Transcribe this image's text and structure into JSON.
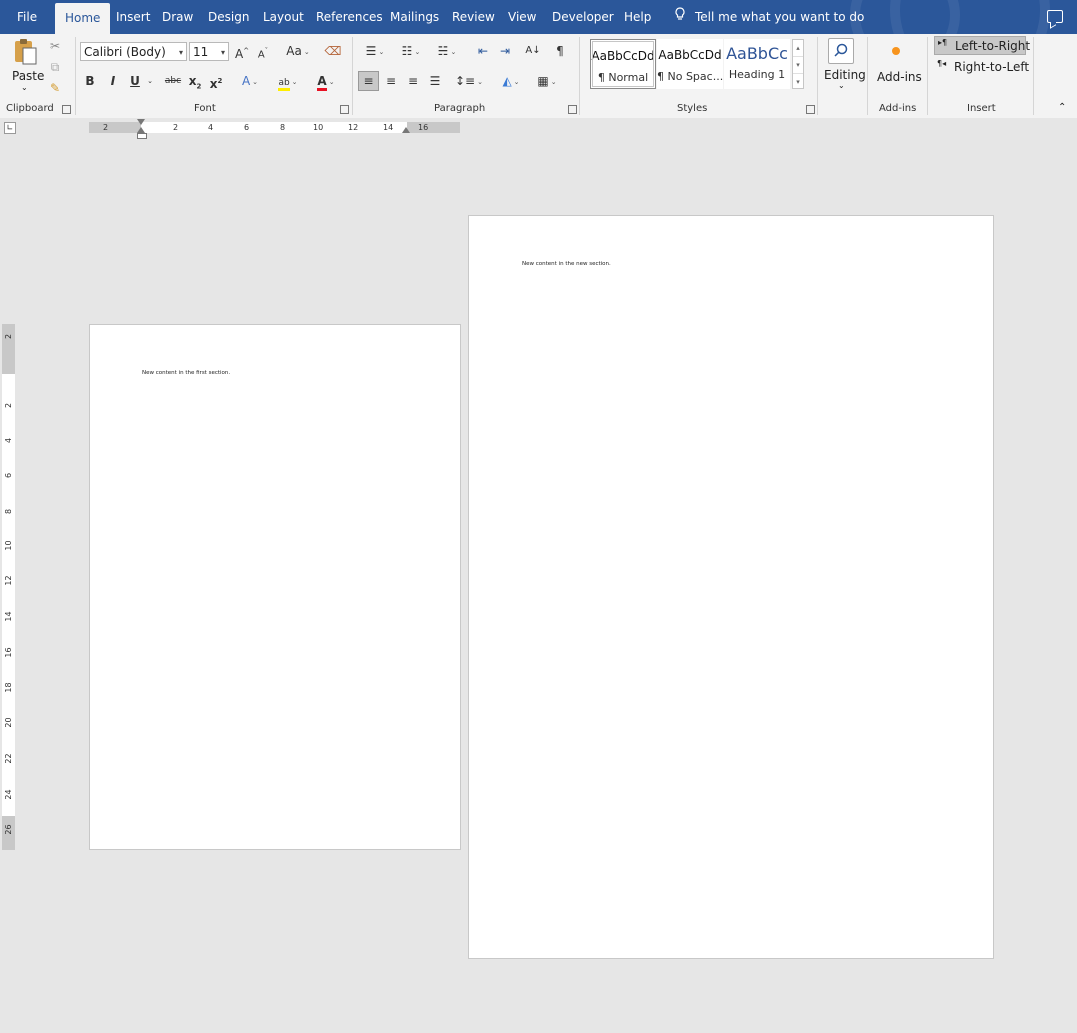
{
  "tabs": [
    {
      "label": "File",
      "active": false
    },
    {
      "label": "Home",
      "active": true
    },
    {
      "label": "Insert",
      "active": false
    },
    {
      "label": "Draw",
      "active": false
    },
    {
      "label": "Design",
      "active": false
    },
    {
      "label": "Layout",
      "active": false
    },
    {
      "label": "References",
      "active": false
    },
    {
      "label": "Mailings",
      "active": false
    },
    {
      "label": "Review",
      "active": false
    },
    {
      "label": "View",
      "active": false
    },
    {
      "label": "Developer",
      "active": false
    },
    {
      "label": "Help",
      "active": false
    }
  ],
  "tell_me": "Tell me what you want to do",
  "clipboard": {
    "paste_label": "Paste",
    "group_label": "Clipboard"
  },
  "font": {
    "font_name": "Calibri (Body)",
    "font_size": "11",
    "grow_label": "A",
    "shrink_label": "A",
    "case_label": "Aa",
    "bold": "B",
    "italic": "I",
    "underline": "U",
    "strike": "abc",
    "subscript": "x",
    "superscript": "x",
    "effects": "A",
    "highlight": "ab",
    "font_color": "A",
    "group_label": "Font",
    "font_color_hex": "#e81123",
    "highlight_hex": "#ffee00"
  },
  "paragraph": {
    "group_label": "Paragraph",
    "show_marks": "¶",
    "sort": "A↓"
  },
  "styles": {
    "items": [
      {
        "preview": "AaBbCcDd",
        "name": "¶ Normal"
      },
      {
        "preview": "AaBbCcDd",
        "name": "¶ No Spac..."
      },
      {
        "preview": "AaBbCc",
        "name": "Heading 1"
      }
    ],
    "group_label": "Styles"
  },
  "editing": {
    "label": "Editing"
  },
  "addins": {
    "label": "Add-ins",
    "group_label": "Add-ins"
  },
  "insert_group": {
    "ltr": "Left-to-Right",
    "rtl": "Right-to-Left",
    "group_label": "Insert",
    "ltr_mark": "▸¶",
    "rtl_mark": "¶◂"
  },
  "hruler_labels": [
    "2",
    "2",
    "4",
    "6",
    "8",
    "10",
    "12",
    "14",
    "16"
  ],
  "vruler_labels": [
    "2",
    "2",
    "4",
    "6",
    "8",
    "10",
    "12",
    "14",
    "16",
    "18",
    "20",
    "22",
    "24",
    "26"
  ],
  "pages": [
    {
      "text": "New content in the first section."
    },
    {
      "text": "New content in the new section."
    }
  ],
  "colors": {
    "ribbon_tab_bar": "#2b579a",
    "ribbon": "#f3f3f3",
    "canvas": "#e6e6e6",
    "heading_blue": "#2f5496"
  }
}
